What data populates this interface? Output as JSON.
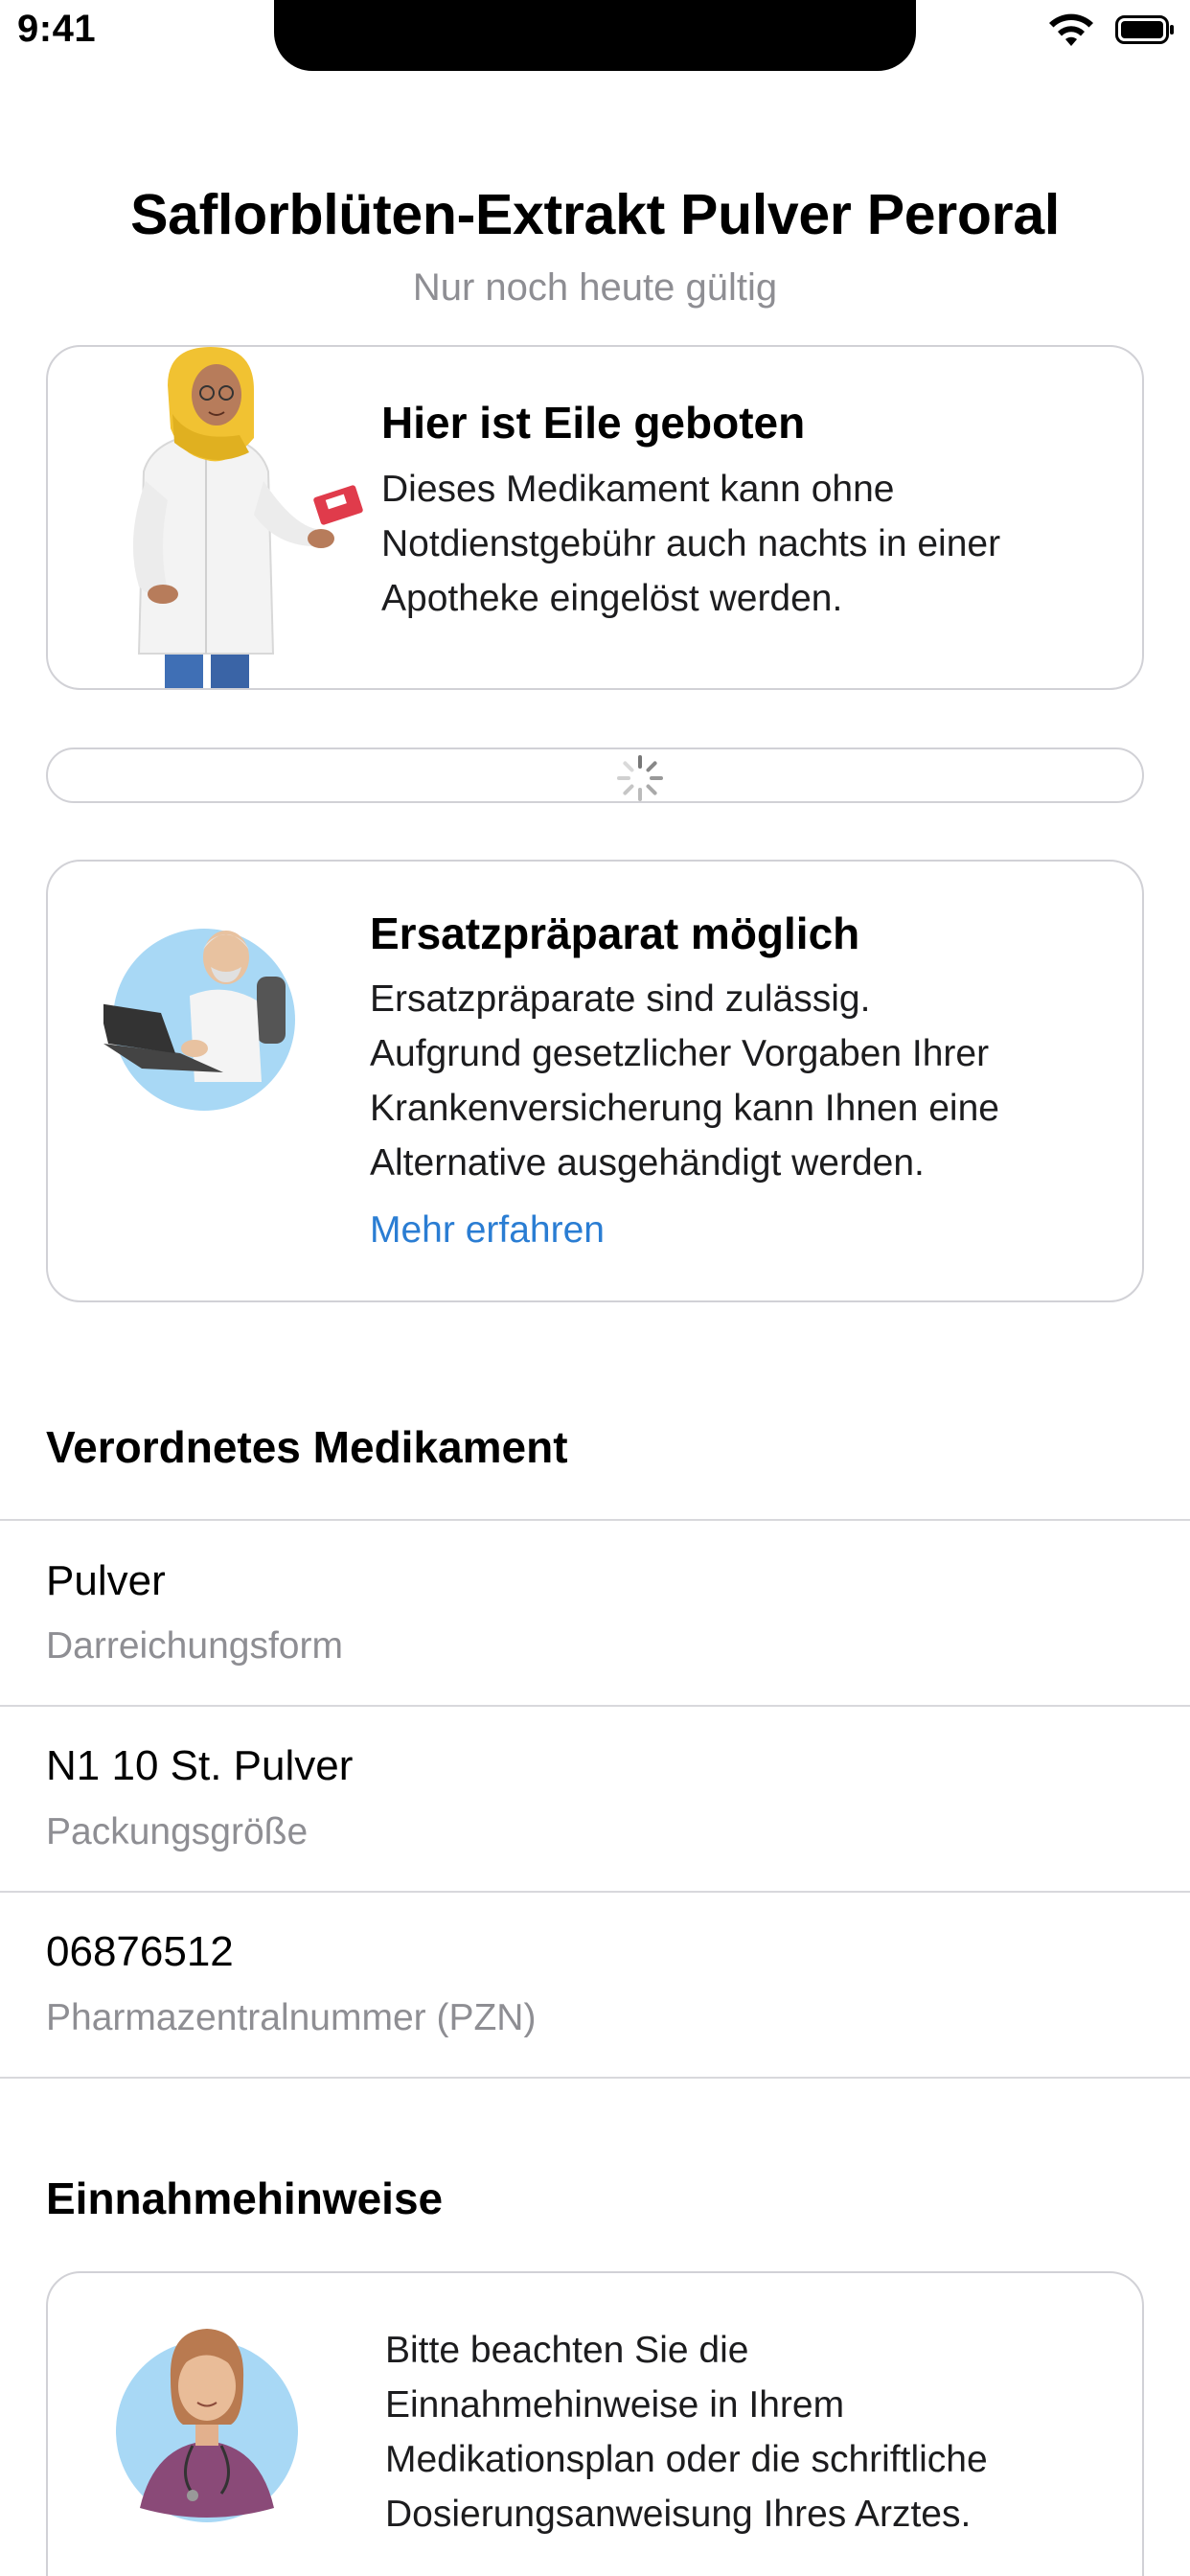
{
  "status_bar": {
    "time": "9:41"
  },
  "header": {
    "title": "Saflorblüten-Extrakt Pulver Peroral",
    "subtitle": "Nur noch heute gültig"
  },
  "urgent_card": {
    "title": "Hier ist Eile geboten",
    "lines": [
      "Dieses Medikament kann ohne",
      "Notdienstgebühr auch nachts in einer",
      "Apotheke eingelöst werden."
    ],
    "illustration": "pharmacist-illustration"
  },
  "loading": {
    "icon": "spinner-icon"
  },
  "substitute_card": {
    "title": "Ersatzpräparat möglich",
    "lines": [
      "Ersatzpräparate sind zulässig.",
      "Aufgrund gesetzlicher Vorgaben Ihrer",
      "Krankenversicherung kann Ihnen eine",
      "Alternative ausgehändigt werden."
    ],
    "link": "Mehr erfahren",
    "illustration": "doctor-laptop-illustration"
  },
  "medication_section": {
    "title": "Verordnetes Medikament",
    "rows": [
      {
        "value": "Pulver",
        "label": "Darreichungsform"
      },
      {
        "value": "N1 10 St. Pulver",
        "label": "Packungsgröße"
      },
      {
        "value": "06876512",
        "label": "Pharmazentralnummer (PZN)"
      }
    ]
  },
  "hints_section": {
    "title": "Einnahmehinweise",
    "lines": [
      "Bitte beachten Sie die",
      "Einnahmehinweise in Ihrem",
      "Medikationsplan oder die schriftliche",
      "Dosierungsanweisung Ihres Arztes."
    ],
    "illustration": "doctor-stethoscope-illustration"
  },
  "colors": {
    "link": "#2a7dd3",
    "secondary_text": "#8e8e93",
    "border": "#d1d1d6",
    "avatar_bg": "#a8d8f5"
  }
}
